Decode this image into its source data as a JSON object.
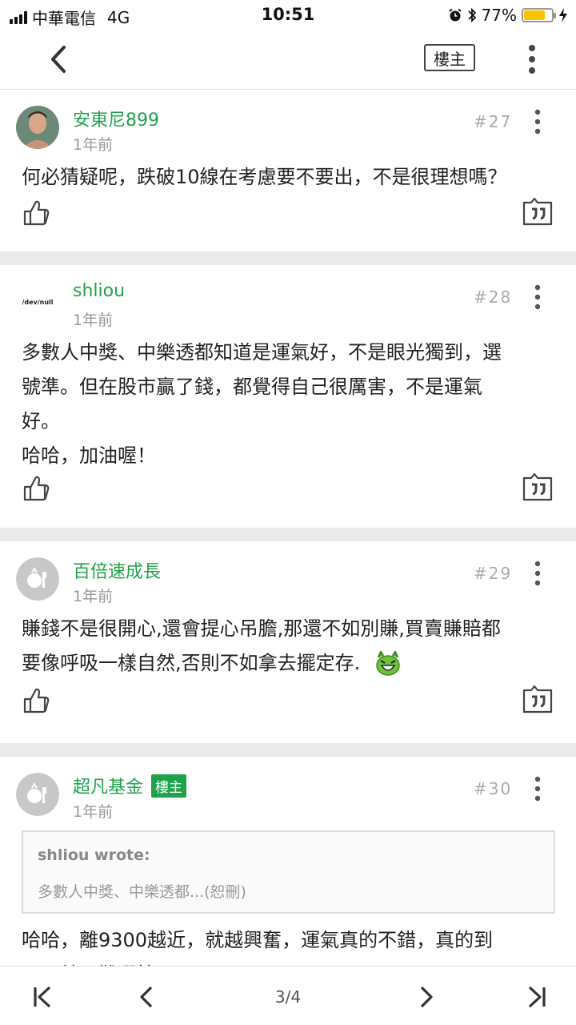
{
  "status_bar": {
    "carrier": "中華電信",
    "network": "4G",
    "time": "10:51",
    "battery": "77%"
  },
  "header": {
    "op_label": "樓主"
  },
  "posts": [
    {
      "username": "安東尼899",
      "time": "1年前",
      "floor": "#27",
      "avatar": "portrait-photo",
      "content": "何必猜疑呢，跌破10線在考慮要不要出，不是很理想嗎？"
    },
    {
      "username": "shliou",
      "time": "1年前",
      "floor": "#28",
      "avatar_text": "/dev/null",
      "content_lines": [
        "多數人中獎、中樂透都知道是運氣好，不是眼光獨到，選",
        "號準。但在股市贏了錢，都覺得自己很厲害，不是運氣",
        "好。",
        "哈哈，加油喔！"
      ]
    },
    {
      "username": "百倍速成長",
      "time": "1年前",
      "floor": "#29",
      "avatar": "default-avatar",
      "content_lines": [
        "賺錢不是很開心,還會提心吊膽,那還不如別賺,買賣賺賠都",
        "要像呼吸一樣自然,否則不如拿去擺定存."
      ],
      "emoji": "grinning-devil-emoji"
    },
    {
      "username": "超凡基金",
      "badge": "樓主",
      "time": "1年前",
      "floor": "#30",
      "avatar": "default-avatar",
      "quote": {
        "author": "shliou wrote:",
        "text": "多數人中獎、中樂透都...(恕刪)"
      },
      "content_lines": [
        "哈哈，離9300越近，就越興奮，運氣真的不錯，真的到",
        "了，就更難選節了"
      ]
    }
  ],
  "pagination": {
    "page": "3/4"
  },
  "colors": {
    "accent": "#1fa34a",
    "separator": "#eaeaea"
  }
}
